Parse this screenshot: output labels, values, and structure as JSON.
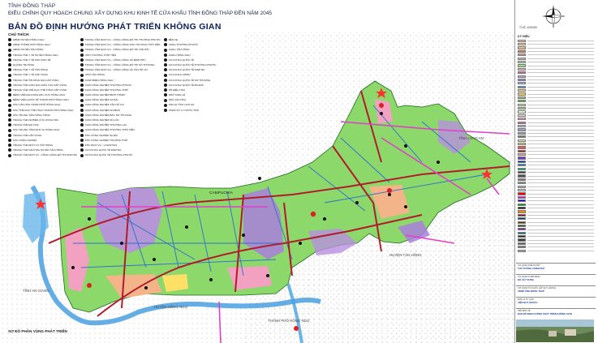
{
  "title": {
    "province": "TỈNH ĐỒNG THÁP",
    "plan": "ĐIỀU CHỈNH QUY HOẠCH CHUNG XÂY DỰNG KHU KINH TẾ CỬA KHẨU TỈNH ĐỒNG THÁP ĐẾN NĂM 2045",
    "main": "BẢN ĐỒ ĐỊNH HƯỚNG PHÁT TRIỂN KHÔNG GIAN"
  },
  "notes": {
    "title": "CHÚ THÍCH:",
    "columns": [
      [
        "UBND HUYỆN HỒNG NGỰ",
        "UBND THÀNH PHỐ HỒNG NGỰ",
        "UBND HUYỆN TÂN HỒNG",
        "TRUNG TÂM Y TẾ HUYỆN HỒNG NGỰ",
        "TRUNG TÂM Y TẾ KHU KINH TẾ",
        "QUẢNG TRƯỜNG",
        "TRUNG TÂM Y TẾ TÂN HỒNG",
        "TRUNG TÂM Y TẾ CẤP VÙNG",
        "TRUNG TÂM THƯƠNG MẠI CẤP VÙNG",
        "TRUNG TÂM GIÁO DỤC ĐÀO TẠO CẤP VÙNG",
        "TRUNG TÂM THỂ DỤC THỂ THAO CẤP VÙNG",
        "BỆNH VIỆN ĐA KHOA KHU VỰC HỒNG NGỰ",
        "BỆNH VIỆN QUỐC TẾ THÀNH PHỐ HỒNG NGỰ",
        "KHU VĂN HÓA THÀNH PHỐ HỒNG NGỰ",
        "KHU THỂ DỤC THỂ THAO THÀNH PHỐ HỒNG NGỰ",
        "KHU TRUNG TÂM CÔNG CỘNG",
        "TRUNG TÂM NGHIÊN CỨU KHOA HỌC",
        "TRUNG TÂM ĐẠI HỌC",
        "KHU TRUNG TÂM DỊCH VỤ HỒNG NGỰ",
        "TRUNG TÂM CẤP VÙNG",
        "KHU CÔNG NGHIỆP",
        "TRUNG TÂM DỊCH VỤ TÂN HỒNG",
        "TRUNG TÂM VĂN HÓA HUYỆN TÂN HỒNG",
        "TRUNG TÂM DỊCH VỤ - CÔNG CỘNG ĐÔ THỊ DINH BÀ"
      ],
      [
        "TRUNG TÂM DỊCH VỤ - CÔNG CỘNG ĐÔ THỊ THƯỜNG PHƯỚC",
        "TRUNG TÂM DỊCH VỤ - CÔNG CỘNG KHU THƯƠNG THỚI TIỀN",
        "TRUNG TÂM DỊCH VỤ - CÔNG CỘNG ĐÔ THỊ TÂN HỘI",
        "CHỢ THƯỜNG THỚI TIỀN",
        "TRUNG TÂM DỊCH VỤ - CÔNG CỘNG XÃ BÌNH PHÚ",
        "TRUNG TÂM DỊCH VỤ - CÔNG CỘNG ĐÔ THỊ SỞ THƯỢNG",
        "TRUNG TÂM DỊCH VỤ - CÔNG CỘNG XÃ TÂN HỘ CƠ",
        "CHỢ TÂN HỒNG",
        "CẢNH BIỂN HỒNG NGỰ",
        "CỤM CÔNG NGHIỆP THƯỜNG PHƯỚC",
        "CỤM CÔNG NGHIỆP THƯỜNG THỚI",
        "CỤM CÔNG NGHIỆP BÌNH THÀNH",
        "CỤM CÔNG NGHIỆP SA RÀI",
        "CỤM CÔNG NGHIỆP TÂN HỘ CƠ",
        "CỤM CÔNG NGHIỆP AN BÌNH",
        "CỤM CÔNG NGHIỆP BẮC SỞ THƯỢNG",
        "CỤM CÔNG NGHIỆP AN LỘC",
        "CỤM CÔNG NGHIỆP THƯỜNG LẠC",
        "CỤM CÔNG NGHIỆP THƯỜNG THỚI TIỀN",
        "KHU CÔNG NGHIỆP SA RÀI",
        "KHU CÔNG NGHIỆP THƯỜNG THỚI",
        "KHU DỊCH VỤ - LOGISTICS",
        "CỬA KHẨU QUỐC TẾ DINH BÀ",
        "CỬA KHẨU QUỐC TẾ THƯỜNG PHƯỚC"
      ],
      [
        "BẾN XE",
        "CẢNG THƯỜNG PHƯỚC",
        "CẢNG TÂN HỒNG",
        "CẢNG HỒNG NGỰ",
        "CỬA KHẨU QUỐC TẾ",
        "CỬA KHẨU QUỐC TẾ THƯỜNG PHƯỚC",
        "CỬA KHẨU QUỐC TẾ DINH BÀ",
        "CỬA KHẨU CHÍNH",
        "CỬA KHẨU QUỐC TẾ SỞ THƯỢNG",
        "CỬA KHẨU QUỐC TẾ BÀ ĐẤC",
        "HỒ ĐIỀU HÒA",
        "NHÀ TANG LỄ",
        "NHÀ VĂN HÓA",
        "KHU DI TÍCH LỊCH SỬ",
        "TRẠM XỬ LÝ NƯỚC THẢI"
      ]
    ]
  },
  "places": {
    "campuchia": "CAMPUCHIA",
    "tinh_an_giang": "TỈNH AN GIANG",
    "long_khanh": "HUYỆN HỒNG NGỰ",
    "tan_hong": "HUYỆN TÂN HỒNG",
    "thanh_pho": "THÀNH PHỐ HỒNG NGỰ",
    "long_an": "TỈNH LONG AN"
  },
  "sub_caption": "SƠ ĐỒ PHÂN VÙNG PHÁT TRIỂN",
  "side": {
    "scale": "TỈ LỆ: 1/25.000",
    "legend_title": "KÝ HIỆU",
    "legend_colors": [
      "#f2c4a0",
      "#f7d9b8",
      "#e8b98a",
      "#e07a3f",
      "#e9a07a",
      "#c8c8c8",
      "#b4e6a5",
      "#9ad98a",
      "#f5b5d0",
      "#e25b9e",
      "#c8a0e6",
      "#b07ad6",
      "#8fc0f0",
      "#5a9ad8",
      "#ffe066",
      "#f7c948",
      "#90d070",
      "#6fb850",
      "#d0e8b8",
      "#a8d88c",
      "#e0f0d0",
      "#f8e0e8",
      "#f0a0c0",
      "#d86a9a",
      "#c0c0e0",
      "#9a9ad0",
      "#a0a0a0",
      "#7a7a7a",
      "#f0f0a0",
      "#e0e070",
      "#ff4d4d",
      "#b01c1c",
      "#ff9e9e",
      "#6a3cc8",
      "#2a2ad0",
      "#00a0d0",
      "#00c080",
      "#3a3a3a",
      "#555555",
      "#777777",
      "#999999",
      "#bbbbbb",
      "#dddddd",
      "#ff0000",
      "#ff00ff",
      "#0000ff",
      "#00aa00",
      "#000000",
      "#ff8800",
      "#aa0000",
      "#004488",
      "#663300",
      "#336633",
      "#aa00aa",
      "#008888",
      "#222222",
      "#444444",
      "#666666",
      "#888888",
      "#aaaaaa"
    ],
    "info_labels": [
      "CƠ QUAN PHÊ DUYỆT",
      "CƠ QUAN THẨM ĐỊNH",
      "CƠ QUAN TỔ CHỨC LẬP QUY HOẠCH",
      "ĐƠN VỊ TƯ VẤN",
      "TÊN BẢN VẼ"
    ],
    "info_values": [
      "THỦ TƯỚNG CHÍNH PHỦ",
      "BỘ XÂY DỰNG",
      "UBND TỈNH ĐỒNG THÁP",
      "VIỆN QUY HOẠCH",
      "BẢN ĐỒ ĐỊNH HƯỚNG PHÁT TRIỂN KHÔNG GIAN"
    ]
  }
}
